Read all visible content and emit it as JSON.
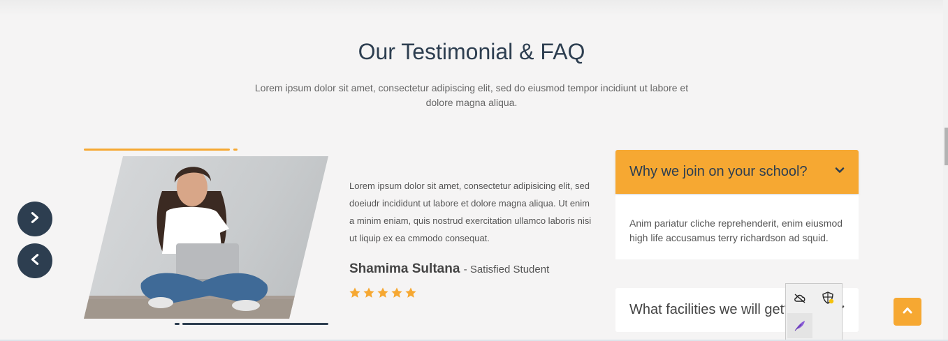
{
  "section": {
    "title": "Our Testimonial & FAQ",
    "subtitle": "Lorem ipsum dolor sit amet, consectetur adipiscing elit, sed do eiusmod tempor incidiunt ut labore et dolore magna aliqua."
  },
  "slider": {
    "next_icon": "chevron-right-icon",
    "prev_icon": "chevron-left-icon"
  },
  "testimonial": {
    "quote": "Lorem ipsum dolor sit amet, consectetur adipisicing elit, sed doeiudr incididunt ut labore et dolore magna aliqua. Ut enim a minim eniam, quis nostrud exercitation ullamco laboris nisi ut liquip ex ea cmmodo consequat.",
    "author_name": "Shamima Sultana",
    "author_role": "- Satisfied Student",
    "rating": 5,
    "rating_max": 5
  },
  "faq": [
    {
      "question": "Why we join on your school?",
      "answer": "Anim pariatur cliche reprehenderit, enim eiusmod high life accusamus terry richardson ad squid.",
      "expanded": true
    },
    {
      "question": "What facilities we will get?",
      "answer": "",
      "expanded": false
    }
  ],
  "tray": {
    "icons": [
      "cloud-off-icon",
      "shield-warning-icon",
      "feather-icon"
    ]
  },
  "colors": {
    "accent": "#f6a832",
    "dark": "#2d3e50",
    "background": "#f5f4f4"
  }
}
